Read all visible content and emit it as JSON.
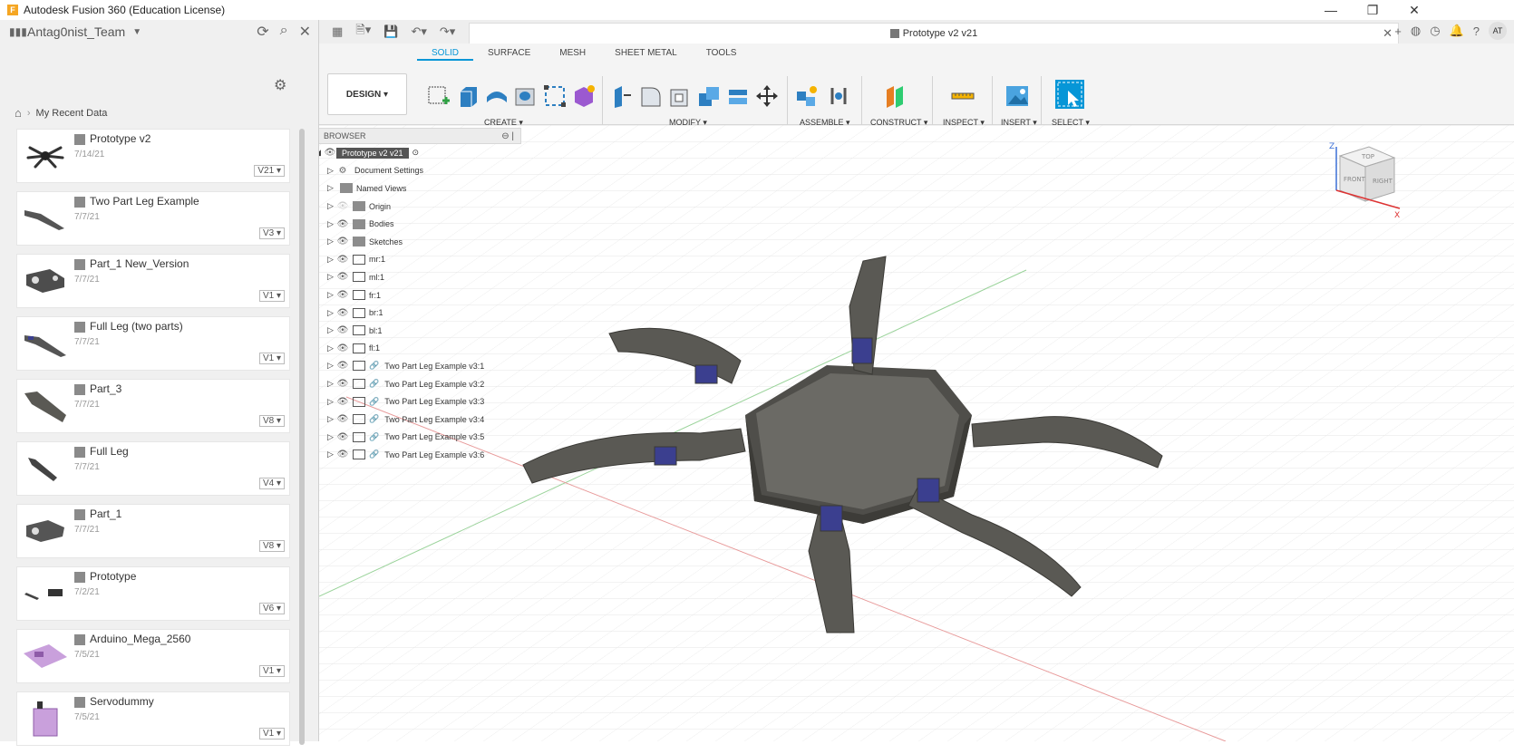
{
  "window": {
    "title": "Autodesk Fusion 360 (Education License)",
    "app_letter": "F",
    "controls": [
      "—",
      "❐",
      "✕"
    ]
  },
  "data_panel": {
    "team_name": "Antag0nist_Team",
    "breadcrumb": "My Recent Data",
    "items": [
      {
        "name": "Prototype v2",
        "date": "7/14/21",
        "version": "V21"
      },
      {
        "name": "Two Part Leg Example",
        "date": "7/7/21",
        "version": "V3"
      },
      {
        "name": "Part_1 New_Version",
        "date": "7/7/21",
        "version": "V1"
      },
      {
        "name": "Full Leg (two parts)",
        "date": "7/7/21",
        "version": "V1"
      },
      {
        "name": "Part_3",
        "date": "7/7/21",
        "version": "V8"
      },
      {
        "name": "Full Leg",
        "date": "7/7/21",
        "version": "V4"
      },
      {
        "name": "Part_1",
        "date": "7/7/21",
        "version": "V8"
      },
      {
        "name": "Prototype",
        "date": "7/2/21",
        "version": "V6"
      },
      {
        "name": "Arduino_Mega_2560",
        "date": "7/5/21",
        "version": "V1"
      },
      {
        "name": "Servodummy",
        "date": "7/5/21",
        "version": "V1"
      }
    ]
  },
  "document": {
    "tab_title": "Prototype  v2 v21",
    "user_initials": "AT"
  },
  "ribbon": {
    "tabs": [
      "SOLID",
      "SURFACE",
      "MESH",
      "SHEET METAL",
      "TOOLS"
    ],
    "workspace": "DESIGN",
    "groups": [
      "CREATE",
      "MODIFY",
      "ASSEMBLE",
      "CONSTRUCT",
      "INSPECT",
      "INSERT",
      "SELECT"
    ]
  },
  "browser": {
    "title": "BROWSER",
    "root": "Prototype  v2 v21",
    "rows": [
      "Document Settings",
      "Named Views",
      "Origin",
      "Bodies",
      "Sketches",
      "mr:1",
      "ml:1",
      "fr:1",
      "br:1",
      "bl:1",
      "fl:1",
      "Two Part Leg Example v3:1",
      "Two Part Leg Example v3:2",
      "Two Part Leg Example v3:3",
      "Two Part Leg Example v3:4",
      "Two Part Leg Example v3:5",
      "Two Part Leg Example v3:6"
    ]
  },
  "viewcube": {
    "faces": [
      "TOP",
      "FRONT",
      "RIGHT"
    ],
    "axes": [
      "Z",
      "X"
    ]
  },
  "colors": {
    "accent": "#0696d7",
    "model": "#5a5954",
    "joint": "#3b3f8f"
  }
}
